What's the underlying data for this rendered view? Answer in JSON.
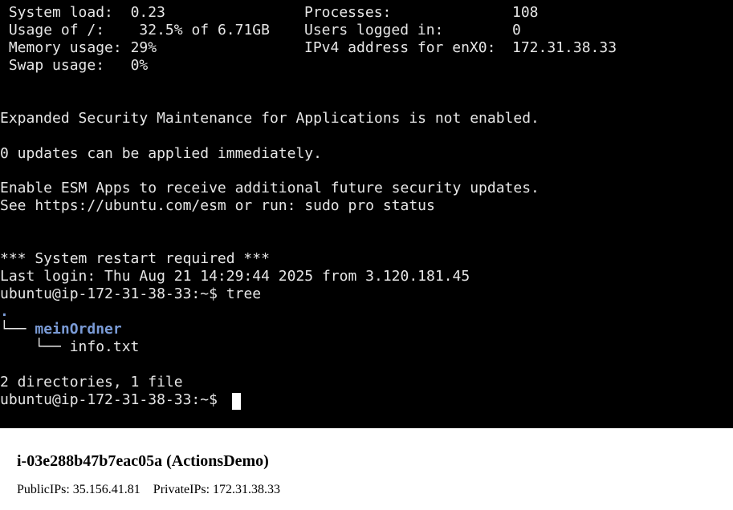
{
  "terminal": {
    "sysinfo": [
      {
        "label": "System load:",
        "value": "0.23",
        "label2": "Processes:",
        "value2": "108"
      },
      {
        "label": "Usage of /:",
        "value": "32.5% of 6.71GB",
        "label2": "Users logged in:",
        "value2": "0"
      },
      {
        "label": "Memory usage:",
        "value": "29%",
        "label2": "IPv4 address for enX0:",
        "value2": "172.31.38.33"
      },
      {
        "label": "Swap usage:",
        "value": "0%"
      }
    ],
    "esm_notice": "Expanded Security Maintenance for Applications is not enabled.",
    "updates_notice": "0 updates can be applied immediately.",
    "esm_apps_line1": "Enable ESM Apps to receive additional future security updates.",
    "esm_apps_line2": "See https://ubuntu.com/esm or run: sudo pro status",
    "restart_notice": "*** System restart required ***",
    "last_login": "Last login: Thu Aug 21 14:29:44 2025 from 3.120.181.45",
    "prompt": "ubuntu@ip-172-31-38-33:~$",
    "command": "tree",
    "tree": {
      "root": ".",
      "branch1": "└── ",
      "dir_name": "meinOrdner",
      "branch2": "    └── ",
      "file_name": "info.txt",
      "summary": "2 directories, 1 file"
    },
    "colors": {
      "background": "#000000",
      "text": "#e6e6e6",
      "directory": "#7a9bd6",
      "cursor": "#ffffff"
    }
  },
  "instance": {
    "title": "i-03e288b47b7eac05a (ActionsDemo)",
    "public_ips_label": "PublicIPs:",
    "public_ips_value": "35.156.41.81",
    "private_ips_label": "PrivateIPs:",
    "private_ips_value": "172.31.38.33"
  }
}
